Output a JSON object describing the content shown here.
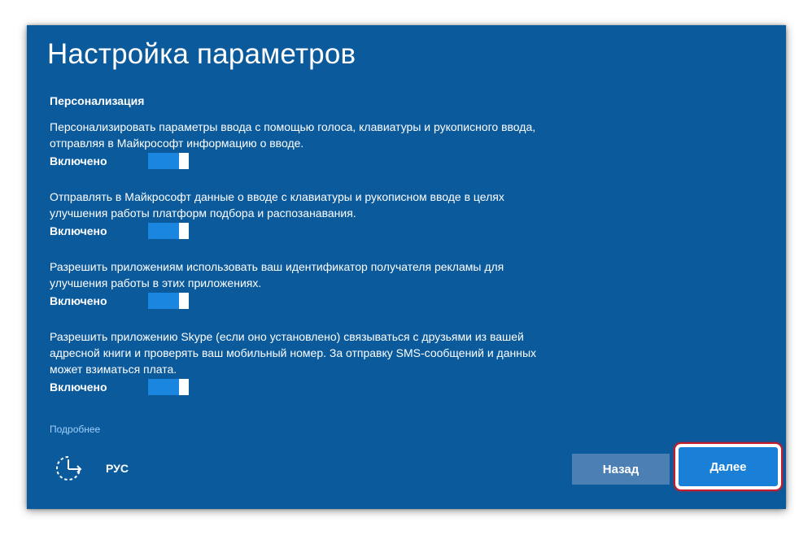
{
  "window": {
    "title": "Настройка параметров"
  },
  "section": {
    "heading": "Персонализация"
  },
  "settings": [
    {
      "line1": "Персонализировать параметры ввода с помощью голоса, клавиатуры и рукописного ввода,",
      "line2": "отправляя в Майкрософт информацию о вводе.",
      "line3": "",
      "state_label": "Включено",
      "enabled": true
    },
    {
      "line1": "Отправлять в Майкрософт данные о вводе с клавиатуры и рукописном вводе в целях",
      "line2": "улучшения работы платформ подбора и распозанавания.",
      "line3": "",
      "state_label": "Включено",
      "enabled": true
    },
    {
      "line1": "Разрешить приложениям использовать ваш идентификатор получателя рекламы для",
      "line2": "улучшения работы в этих приложениях.",
      "line3": "",
      "state_label": "Включено",
      "enabled": true
    },
    {
      "line1": "Разрешить приложению Skype (если оно установлено) связываться с друзьями из вашей",
      "line2": "адресной книги и проверять ваш мобильный номер. За отправку SMS-сообщений и данных",
      "line3": "может взиматься плата.",
      "state_label": "Включено",
      "enabled": true
    }
  ],
  "links": {
    "learn_more": "Подробнее"
  },
  "footer": {
    "accessibility_icon": "ease-of-access-icon",
    "language": "РУС",
    "back_label": "Назад",
    "next_label": "Далее"
  },
  "colors": {
    "background": "#0b5a9c",
    "toggle_on": "#1a86e0",
    "back_button": "#4c7fb4",
    "next_button": "#1a7fd6",
    "highlight_ring": "#c81c2a"
  }
}
